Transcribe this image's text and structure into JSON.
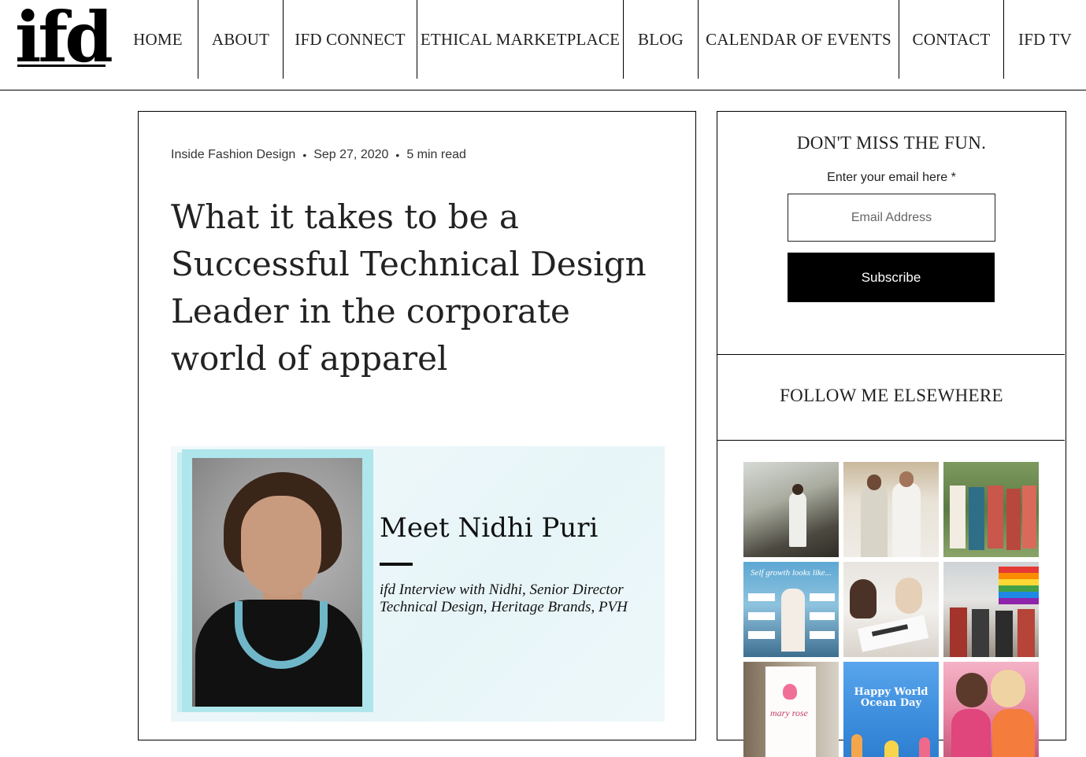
{
  "header": {
    "logo": "ifd",
    "nav": [
      "HOME",
      "ABOUT",
      "IFD CONNECT",
      "ETHICAL MARKETPLACE",
      "BLOG",
      "CALENDAR OF EVENTS",
      "CONTACT",
      "IFD TV"
    ]
  },
  "post": {
    "author": "Inside Fashion Design",
    "date": "Sep 27, 2020",
    "read_time": "5 min read",
    "title": "What it takes to be a Successful Technical Design Leader in the corporate world of apparel",
    "hero": {
      "name": "Meet Nidhi Puri",
      "subtitle": "ifd Interview with Nidhi, Senior Director Technical Design,  Heritage Brands, PVH"
    }
  },
  "sidebar": {
    "newsletter": {
      "heading": "DON'T MISS THE FUN.",
      "label": "Enter your email here *",
      "placeholder": "Email Address",
      "button": "Subscribe"
    },
    "follow": {
      "heading": "FOLLOW ME ELSEWHERE",
      "tiles": [
        {
          "name": "instagram-tile-studio",
          "caption": ""
        },
        {
          "name": "instagram-tile-models",
          "caption": ""
        },
        {
          "name": "instagram-tile-dresses",
          "caption": ""
        },
        {
          "name": "instagram-tile-self-growth",
          "caption": "Self growth looks like..."
        },
        {
          "name": "instagram-tile-design-meeting",
          "caption": ""
        },
        {
          "name": "instagram-tile-pride-event",
          "caption": ""
        },
        {
          "name": "instagram-tile-mary-rose",
          "caption": "mary rose"
        },
        {
          "name": "instagram-tile-ocean-day",
          "caption": "Happy World Ocean Day"
        },
        {
          "name": "instagram-tile-friends",
          "caption": ""
        }
      ]
    }
  }
}
